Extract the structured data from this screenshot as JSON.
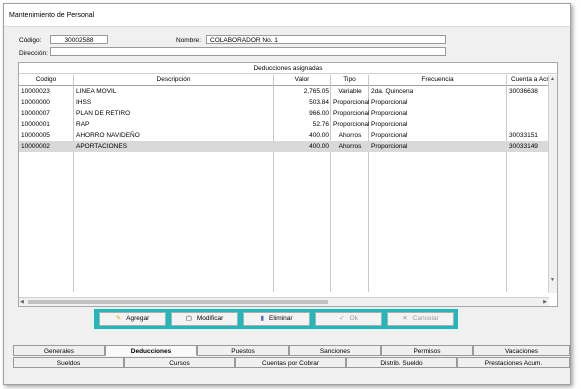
{
  "window": {
    "title": "Mantenimiento de Personal"
  },
  "form": {
    "codigo_label": "Código:",
    "codigo_value": "30002588",
    "nombre_label": "Nombre:",
    "nombre_value": "COLABORADOR No. 1",
    "direccion_label": "Dirección:",
    "direccion_value": ""
  },
  "deducciones": {
    "title": "Deducciones asignadas",
    "columns": [
      "Codigo",
      "Descripción",
      "Valor",
      "Tipo",
      "Frecuencia",
      "Cuenta a Acredit"
    ],
    "rows": [
      {
        "codigo": "10000023",
        "descripcion": "LINEA MOVIL",
        "valor": "2,765.05",
        "tipo": "Variable",
        "frecuencia": "2da. Quincena",
        "cuenta": "30036638"
      },
      {
        "codigo": "10000000",
        "descripcion": "IHSS",
        "valor": "503.84",
        "tipo": "Proporcional",
        "frecuencia": "Proporcional",
        "cuenta": ""
      },
      {
        "codigo": "10000007",
        "descripcion": "PLAN DE RETIRO",
        "valor": "966.00",
        "tipo": "Proporcional",
        "frecuencia": "Proporcional",
        "cuenta": ""
      },
      {
        "codigo": "10000001",
        "descripcion": "RAP",
        "valor": "52.76",
        "tipo": "Proporcional",
        "frecuencia": "Proporcional",
        "cuenta": ""
      },
      {
        "codigo": "10000005",
        "descripcion": "AHORRO NAVIDEÑO",
        "valor": "400.00",
        "tipo": "Ahorros",
        "frecuencia": "Proporcional",
        "cuenta": "30033151"
      },
      {
        "codigo": "10000002",
        "descripcion": "APORTACIONES",
        "valor": "400.00",
        "tipo": "Ahorros",
        "frecuencia": "Proporcional",
        "cuenta": "30033149"
      }
    ],
    "selected_row": 5
  },
  "actions": {
    "agregar": "Agregar",
    "modificar": "Modificar",
    "eliminar": "Eliminar",
    "ok": "Ok",
    "cancelar": "Cancelar"
  },
  "tabs_row1": [
    "Generales",
    "Deducciones",
    "Puestos",
    "Sanciones",
    "Permisos",
    "Vacaciones"
  ],
  "tabs_row2": [
    "Sueldos",
    "Cursos",
    "Cuentas por Cobrar",
    "Distrib. Sueldo",
    "Prestaciones Acum."
  ],
  "active_tab": "Deducciones",
  "colors": {
    "accent_bar": "#20b8b8",
    "selected_row": "#d9d9d9"
  }
}
